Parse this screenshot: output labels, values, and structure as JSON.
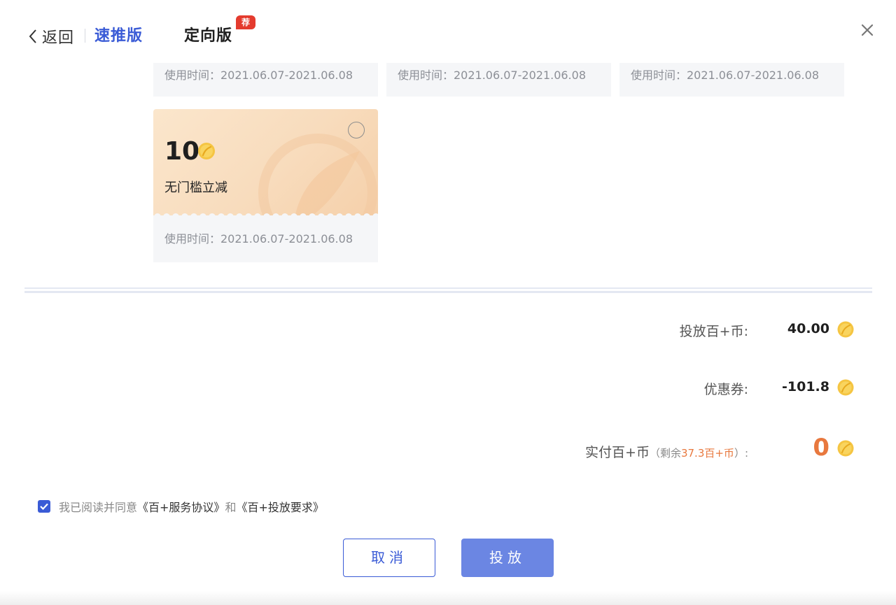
{
  "header": {
    "back_label": "返回",
    "tab_speed": "速推版",
    "tab_target": "定向版",
    "badge": "荐"
  },
  "stubs": [
    {
      "time": "使用时间：2021.06.07-2021.06.08"
    },
    {
      "time": "使用时间：2021.06.07-2021.06.08"
    },
    {
      "time": "使用时间：2021.06.07-2021.06.08"
    }
  ],
  "coupon": {
    "amount": "10",
    "desc": "无门槛立减",
    "time": "使用时间：2021.06.07-2021.06.08",
    "selected": false
  },
  "summary": {
    "launch_label": "投放百+币:",
    "launch_value": "40.00",
    "coupon_label": "优惠券:",
    "coupon_value": "-101.8",
    "pay_label": "实付百+币",
    "remain_prefix": "（剩余",
    "remain_value": "37.3百+币",
    "remain_suffix": "）:",
    "pay_value": "0"
  },
  "agreement": {
    "prefix": "我已阅读并同意",
    "link1": "《百+服务协议》",
    "mid": "和",
    "link2": "《百+投放要求》",
    "checked": true
  },
  "buttons": {
    "cancel": "取消",
    "submit": "投放"
  },
  "colors": {
    "accent": "#3a5bd6",
    "submit": "#6b86e3",
    "orange": "#e8783e",
    "badge": "#e43b2e"
  }
}
